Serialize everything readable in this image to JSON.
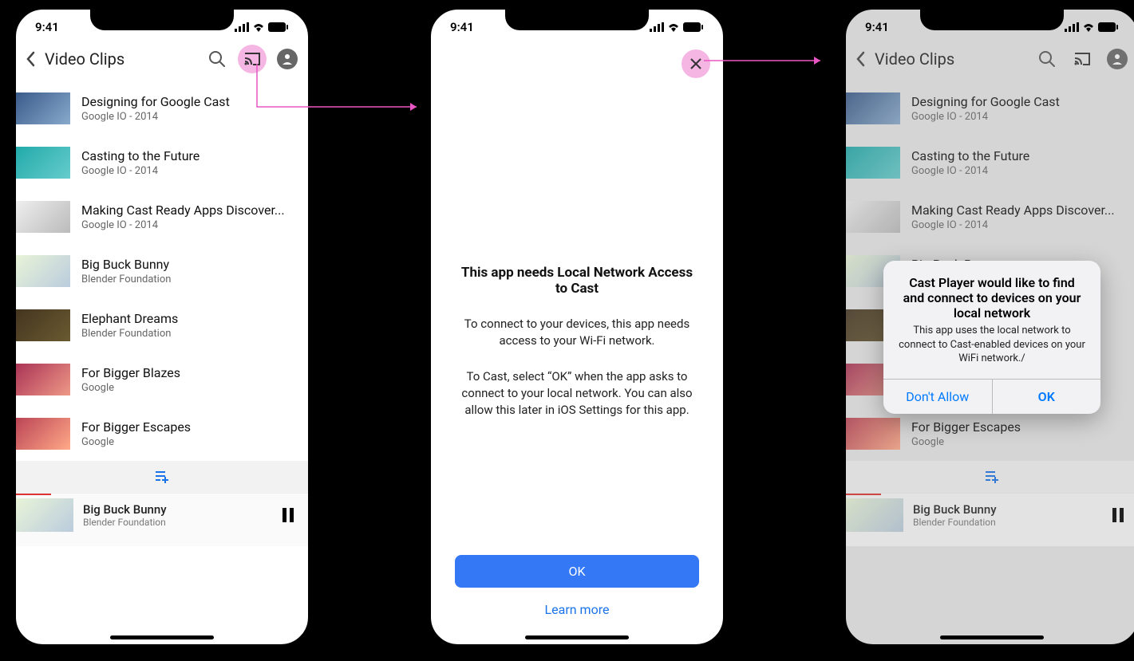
{
  "status": {
    "time": "9:41"
  },
  "header": {
    "title": "Video Clips"
  },
  "videos": [
    {
      "title": "Designing for Google Cast",
      "subtitle": "Google IO - 2014"
    },
    {
      "title": "Casting to the Future",
      "subtitle": "Google IO - 2014"
    },
    {
      "title": "Making Cast Ready Apps Discover...",
      "subtitle": "Google IO - 2014"
    },
    {
      "title": "Big Buck Bunny",
      "subtitle": "Blender Foundation"
    },
    {
      "title": "Elephant Dreams",
      "subtitle": "Blender Foundation"
    },
    {
      "title": "For Bigger Blazes",
      "subtitle": "Google"
    },
    {
      "title": "For Bigger Escapes",
      "subtitle": "Google"
    }
  ],
  "mini": {
    "title": "Big Buck Bunny",
    "subtitle": "Blender Foundation"
  },
  "screen2": {
    "heading": "This app needs Local Network Access to Cast",
    "p1": "To connect to your devices, this app needs access to your Wi-Fi network.",
    "p2": "To Cast, select “OK” when the app asks to connect to your local network. You can also allow this later in iOS Settings for this app.",
    "ok": "OK",
    "learn": "Learn more"
  },
  "alert": {
    "title": "Cast Player would like to find and connect to devices on your local network",
    "msg": "This app uses the local network to connect to Cast-enabled devices on your WiFi network./",
    "dont": "Don't Allow",
    "ok": "OK"
  }
}
